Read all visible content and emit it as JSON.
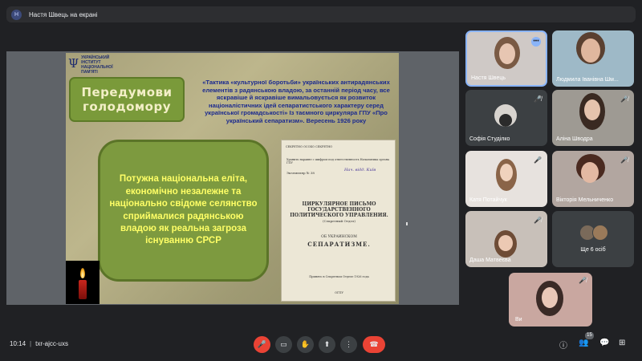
{
  "topbar": {
    "avatar_letter": "Н",
    "presenting": "Настя Швець на екрані"
  },
  "slide": {
    "logo_symbol": "Ψ",
    "logo_text": "УКРАЇНСЬКИЙ ІНСТИТУТ НАЦІОНАЛЬНОЇ ПАМ'ЯТІ",
    "title_line1": "Передумови",
    "title_line2": "голодомору",
    "quote": "«Тактика «культурної боротьби» українських антирадянських елементів з радянською владою, за останній період часу, все яскравіше й яскравіше вимальовується як розвиток націоналістичних ідей сепаратистського характеру серед української громадськості» Із таємного циркуляра ГПУ «Про український сепаратизм». Вересень 1926 року",
    "main_text": "Потужна національна еліта, економічно незалежне та національно свідоме селянство сприймалися радянською владою як реальна загроза існуванню СРСР",
    "doc": {
      "l1": "СЕКРЕТНО ОСОБО СЕКРЕТНО",
      "l2": "Хранить наравне с шифром под ответственность Начальника органа ГПУ",
      "l3": "Экземпляр № 38",
      "hand": "Нач. відд. Київ",
      "l4": "ЦИРКУЛЯРНОЕ ПИСЬМО ГОСУДАРСТВЕННОГО ПОЛИТИЧЕСКОГО УПРАВЛЕНИЯ.",
      "l5": "(Секретный Отдел)",
      "l6": "ОБ УКРАИНСКОМ",
      "l7": "СЕПАРАТИЗМЕ.",
      "l8": "Принято в Секретном Отделе 1926 года",
      "l9": "ОГПУ"
    }
  },
  "participants": [
    {
      "name": "Настя Швець"
    },
    {
      "name": "Людмила Іванівна Шм..."
    },
    {
      "name": "Софія Студілко"
    },
    {
      "name": "Аліна Шводра"
    },
    {
      "name": "Катя Потайчук"
    },
    {
      "name": "Вікторія Мельниченко"
    },
    {
      "name": "Даша Матвеєва"
    },
    {
      "name": "Ще 6 осіб"
    },
    {
      "name": "Ви"
    }
  ],
  "bottom": {
    "time": "10:14",
    "separator": "|",
    "meeting_code": "txr-ajcc-uxs",
    "participants_count": "15"
  },
  "colors": {
    "accent": "#8ab4f8",
    "danger": "#ea4335",
    "bg": "#202124"
  },
  "icons": [
    "mic-off-icon",
    "camera-icon",
    "raise-hand-icon",
    "present-icon",
    "more-icon",
    "leave-call-icon",
    "info-icon",
    "people-icon",
    "chat-icon",
    "activities-icon"
  ]
}
